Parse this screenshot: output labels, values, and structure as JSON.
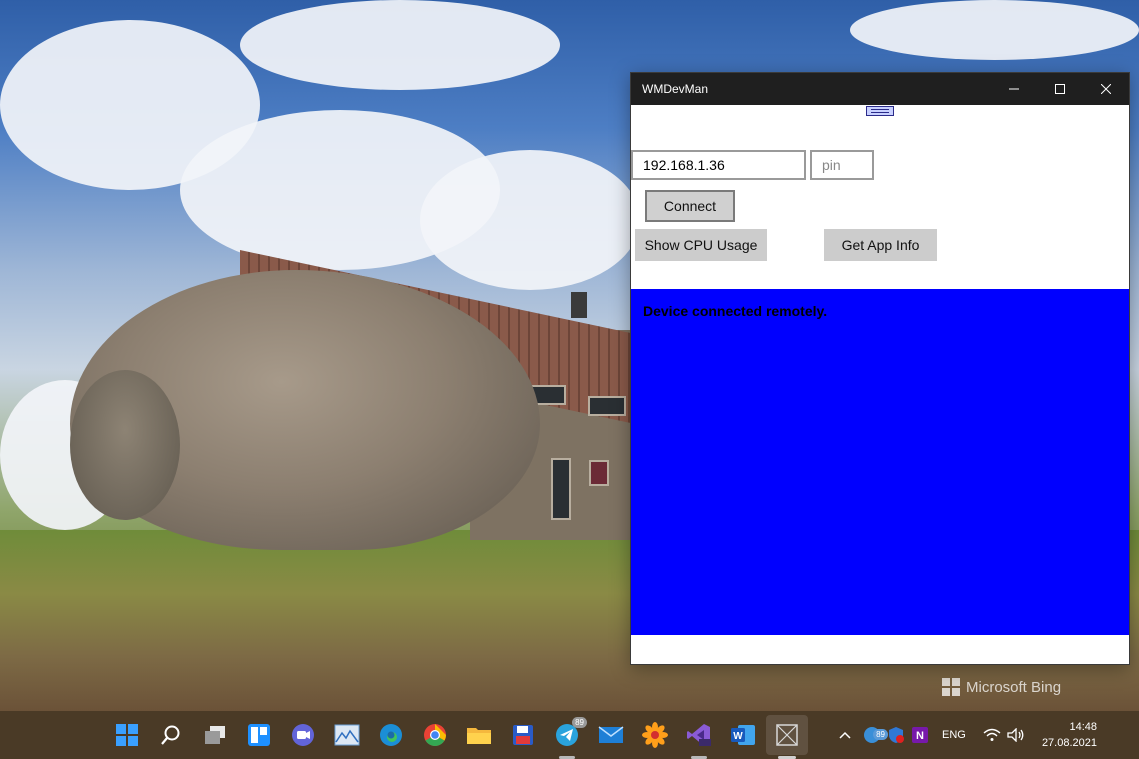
{
  "window": {
    "title": "WMDevMan",
    "minimize_glyph": "—",
    "maximize_glyph": "☐",
    "close_glyph": "✕"
  },
  "form": {
    "ip_value": "192.168.1.36",
    "pin_placeholder": "pin",
    "connect_label": "Connect",
    "show_cpu_label": "Show CPU Usage",
    "get_app_info_label": "Get App Info"
  },
  "output": {
    "text": "Device connected remotely.",
    "background": "#0000ff"
  },
  "desktop": {
    "watermark": "Microsoft Bing"
  },
  "taskbar": {
    "icons": [
      "start-icon",
      "search-icon",
      "task-view-icon",
      "widgets-icon",
      "teams-chat-icon",
      "photos-icon",
      "edge-icon",
      "chrome-icon",
      "file-explorer-icon",
      "save-app-icon",
      "telegram-icon",
      "mail-icon",
      "flower-app-icon",
      "visual-studio-preview-icon",
      "word-icon",
      "wmdevman-app-icon"
    ],
    "telegram_badge": "89",
    "tray_badge": "89",
    "language": "ENG",
    "time": "14:48",
    "date": "27.08.2021"
  }
}
